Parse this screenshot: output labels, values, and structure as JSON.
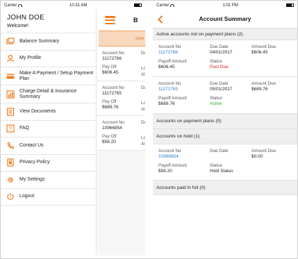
{
  "left": {
    "status": {
      "carrier": "Carrier",
      "time": "10:31 AM"
    },
    "user": {
      "name": "JOHN DOE",
      "greeting": "Welcome!"
    },
    "menu": [
      {
        "label": "Balance Summary",
        "icon": "balance-icon"
      },
      {
        "label": "My Profile",
        "icon": "profile-icon"
      },
      {
        "label": "Make A Payment / Setup Payment Plan",
        "icon": "card-icon"
      },
      {
        "label": "Charge Detail & Insurance Summary",
        "icon": "chart-icon"
      },
      {
        "label": "View Documents",
        "icon": "documents-icon"
      },
      {
        "label": "FAQ",
        "icon": "faq-icon"
      },
      {
        "label": "Contact Us",
        "icon": "phone-icon"
      },
      {
        "label": "Privacy Policy",
        "icon": "policy-icon"
      },
      {
        "label": "My Settings",
        "icon": "settings-icon"
      },
      {
        "label": "Logout",
        "icon": "logout-icon"
      }
    ],
    "peek": {
      "title": "B",
      "banner": "GUA",
      "cards": [
        {
          "acct_label": "Account No",
          "acct": "11172766",
          "side1": "Du",
          "pay_label": "Pay Off",
          "pay": "$606.45",
          "side2": "Lo",
          "side3": "Al"
        },
        {
          "acct_label": "Account No",
          "acct": "11172765",
          "side1": "Du",
          "pay_label": "Pay Off",
          "pay": "$689.76",
          "side2": "Lo",
          "side3": "Al"
        },
        {
          "acct_label": "Account No",
          "acct": "10966854",
          "side1": "Du",
          "pay_label": "Pay Off",
          "pay": "$58.20",
          "side2": "Lo",
          "side3": "Al"
        }
      ]
    }
  },
  "right": {
    "status": {
      "carrier": "Carrier",
      "time": "1:01 PM"
    },
    "title": "Account Summary",
    "sections": {
      "active": "Active accounts not on payment plans (2)",
      "plans": "Accounts on payment plans (0)",
      "hold": "Accounts on hold (1)",
      "paid": "Accounts paid in full (0)"
    },
    "labels": {
      "account_no": "Account No",
      "due_date": "Due Date",
      "amount_due": "Amount Due",
      "payoff": "Payoff Amount",
      "status": "Status"
    },
    "accounts": [
      {
        "account": "11172766",
        "due_date": "04/01/2017",
        "amount_due": "$606.45",
        "payoff": "$606.45",
        "status": "Past Due"
      },
      {
        "account": "11172765",
        "due_date": "05/01/2017",
        "amount_due": "$689.76",
        "payoff": "$689.76",
        "status": "Active"
      }
    ],
    "hold_account": {
      "account": "10966854",
      "due_date": "",
      "amount_due": "$0.00",
      "payoff": "$58.20",
      "status": "Hold Status"
    }
  },
  "colors": {
    "accent": "#f07c20",
    "link": "#2a7fd4",
    "past_due": "#e02020",
    "active": "#2fa02f",
    "section_bg": "#efefef"
  }
}
